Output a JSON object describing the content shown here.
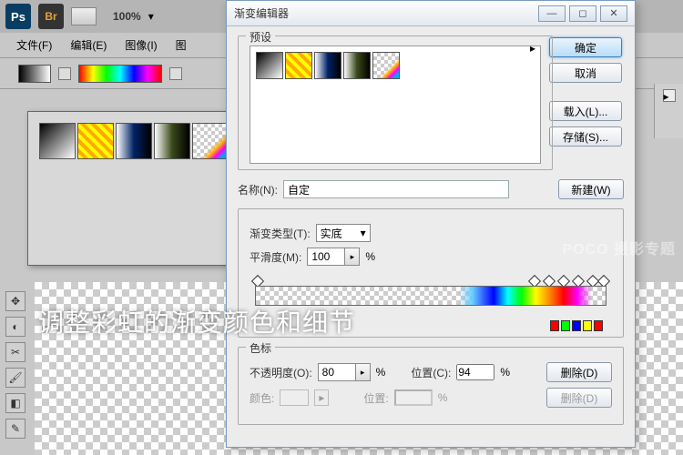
{
  "topbar": {
    "app": "Ps",
    "bridge": "Br",
    "zoom": "100%"
  },
  "menu": {
    "file": "文件(F)",
    "edit": "编辑(E)",
    "image": "图像(I)",
    "image2": "图"
  },
  "dialog": {
    "title": "渐变编辑器",
    "presets_label": "预设",
    "buttons": {
      "ok": "确定",
      "cancel": "取消",
      "load": "载入(L)...",
      "save": "存储(S)...",
      "new": "新建(W)",
      "delete": "删除(D)"
    },
    "name_label": "名称(N):",
    "name_value": "自定",
    "type_label": "渐变类型(T):",
    "type_value": "实底",
    "smooth_label": "平滑度(M):",
    "smooth_value": "100",
    "percent": "%",
    "stops_label": "色标",
    "opacity_label": "不透明度(O):",
    "opacity_value": "80",
    "position_label": "位置(C):",
    "position_value": "94",
    "color_label": "颜色:",
    "position2_label": "位置:"
  },
  "overlay": "调整彩虹的渐变颜色和细节",
  "watermark": "POCO 摄影专题"
}
